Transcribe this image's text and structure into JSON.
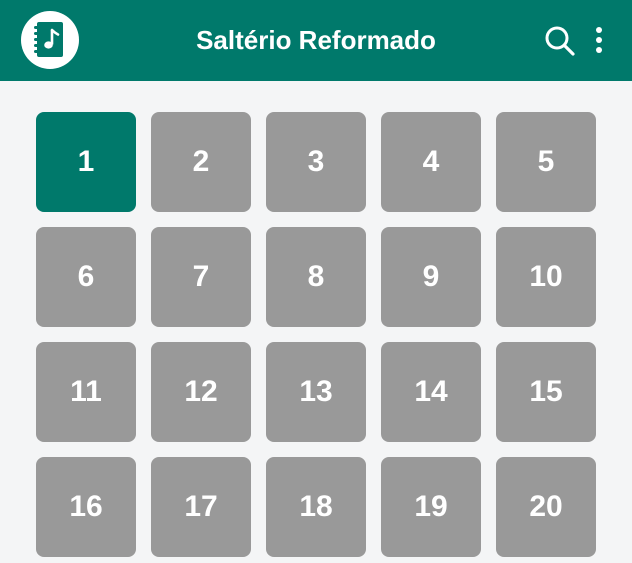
{
  "app": {
    "title": "Saltério Reformado",
    "icons": {
      "logo": "music-book-icon",
      "search": "search-icon",
      "menu": "more-vertical-icon"
    }
  },
  "colors": {
    "primary": "#00796b",
    "tile": "#999999",
    "background": "#f4f5f6",
    "text_on_primary": "#ffffff"
  },
  "psalms": {
    "selected": "1",
    "items": [
      "1",
      "2",
      "3",
      "4",
      "5",
      "6",
      "7",
      "8",
      "9",
      "10",
      "11",
      "12",
      "13",
      "14",
      "15",
      "16",
      "17",
      "18",
      "19",
      "20"
    ]
  }
}
